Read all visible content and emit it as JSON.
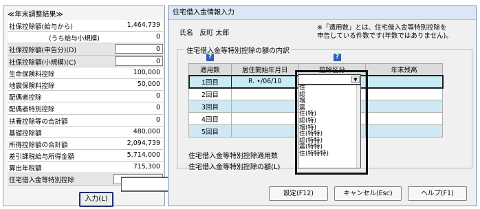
{
  "left": {
    "title": "≪年末調整結果≫",
    "rows": [
      {
        "label": "社保控除額(給与から)",
        "value": "1,464,739"
      },
      {
        "label": "(うち給与小規模)",
        "value": "0"
      },
      {
        "label": "社保控除額(申告分)(D)",
        "value": "0"
      },
      {
        "label": "社保控除額(小規模)(C)",
        "value": "0"
      },
      {
        "label": "生命保険料控除",
        "value": "100,000"
      },
      {
        "label": "地震保険料控除",
        "value": "50,000"
      },
      {
        "label": "配偶者控除",
        "value": "0"
      },
      {
        "label": "配偶者特別控除",
        "value": "0"
      },
      {
        "label": "扶養控除等の合計額",
        "value": "0"
      },
      {
        "label": "基礎控除額",
        "value": "480,000"
      },
      {
        "label": "所得控除額の合計額",
        "value": "2,094,739"
      },
      {
        "label": "差引課税給与所得金額",
        "value": "5,714,000"
      },
      {
        "label": "算出年税額",
        "value": "715,300"
      },
      {
        "label": "住宅借入金等特別控除",
        "value": ""
      }
    ],
    "input_button": "入力(L)"
  },
  "dialog": {
    "title": "住宅借入金情報入力",
    "name_label": "氏名",
    "name_value": "反町 太郎",
    "note_line1": "※「適用数」とは、住宅借入金等特別控除を",
    "note_line2": "申告している件数です(年数ではありません)。",
    "group_title": "住宅借入金等特別控除の額の内訳",
    "help_icon": "?",
    "columns": [
      "適用数",
      "居住開始年月日",
      "控除区分",
      "年末残高"
    ],
    "rows": [
      {
        "num": "1回目",
        "date": "R. •/06/10"
      },
      {
        "num": "2回目",
        "date": ""
      },
      {
        "num": "3回目",
        "date": ""
      },
      {
        "num": "4回目",
        "date": ""
      },
      {
        "num": "5回目",
        "date": ""
      }
    ],
    "dropdown_options": [
      "",
      "住",
      "認",
      "増",
      "震",
      "住(特)",
      "認(特)",
      "増(特)",
      "住(特特)",
      "認(特特)",
      "震(特特)",
      "住(特特特)"
    ],
    "sum_label1": "住宅借入金等特別控除適用数",
    "sum_label2": "住宅借入金等特別控除の額(L)",
    "buttons": {
      "ok": "設定(F12)",
      "cancel": "キャンセル(Esc)",
      "help": "ヘルプ(F1)"
    }
  }
}
